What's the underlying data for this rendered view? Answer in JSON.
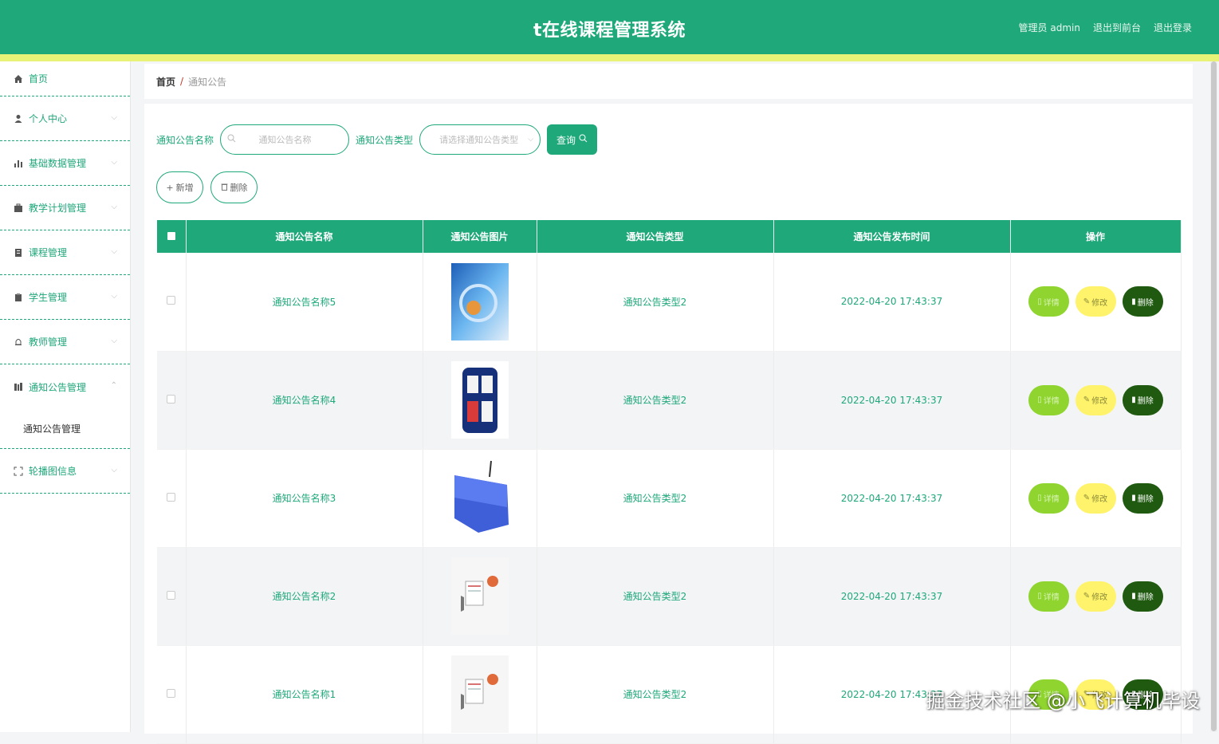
{
  "header": {
    "title": "t在线课程管理系统",
    "user": "管理员 admin",
    "link_front": "退出到前台",
    "link_logout": "退出登录"
  },
  "sidebar": {
    "items": [
      {
        "label": "首页",
        "icon": "home-icon"
      },
      {
        "label": "个人中心",
        "icon": "user-icon"
      },
      {
        "label": "基础数据管理",
        "icon": "bar-chart-icon"
      },
      {
        "label": "教学计划管理",
        "icon": "briefcase-icon"
      },
      {
        "label": "课程管理",
        "icon": "document-icon"
      },
      {
        "label": "学生管理",
        "icon": "clipboard-icon"
      },
      {
        "label": "教师管理",
        "icon": "bell-icon"
      },
      {
        "label": "通知公告管理",
        "icon": "news-icon"
      },
      {
        "label": "轮播图信息",
        "icon": "fullscreen-icon"
      }
    ],
    "submenu_label": "通知公告管理"
  },
  "breadcrumb": {
    "home": "首页",
    "sep": "/",
    "current": "通知公告"
  },
  "search": {
    "name_label": "通知公告名称",
    "name_placeholder": "通知公告名称",
    "type_label": "通知公告类型",
    "type_placeholder": "请选择通知公告类型",
    "query_label": "查询"
  },
  "actions": {
    "add_label": "新增",
    "delete_label": "删除"
  },
  "table": {
    "columns": [
      "通知公告名称",
      "通知公告图片",
      "通知公告类型",
      "通知公告发布时间",
      "操作"
    ],
    "rows": [
      {
        "name": "通知公告名称5",
        "image": "blue-abstract",
        "type": "通知公告类型2",
        "time": "2022-04-20 17:43:37"
      },
      {
        "name": "通知公告名称4",
        "image": "cctv-news-logo",
        "type": "通知公告类型2",
        "time": "2022-04-20 17:43:37"
      },
      {
        "name": "通知公告名称3",
        "image": "news-sign",
        "type": "通知公告类型2",
        "time": "2022-04-20 17:43:37"
      },
      {
        "name": "通知公告名称2",
        "image": "news-megaphone",
        "type": "通知公告类型2",
        "time": "2022-04-20 17:43:37"
      },
      {
        "name": "通知公告名称1",
        "image": "news-megaphone",
        "type": "通知公告类型2",
        "time": "2022-04-20 17:43:37"
      }
    ],
    "op_detail": "详情",
    "op_edit": "修改",
    "op_delete": "删除"
  },
  "watermark": "掘金技术社区 @小飞计算机毕设",
  "colors": {
    "primary": "#1fa87a",
    "stripe": "#e8f276",
    "detail": "#8fd42f",
    "edit": "#fff36b",
    "delete": "#1f5a10"
  }
}
